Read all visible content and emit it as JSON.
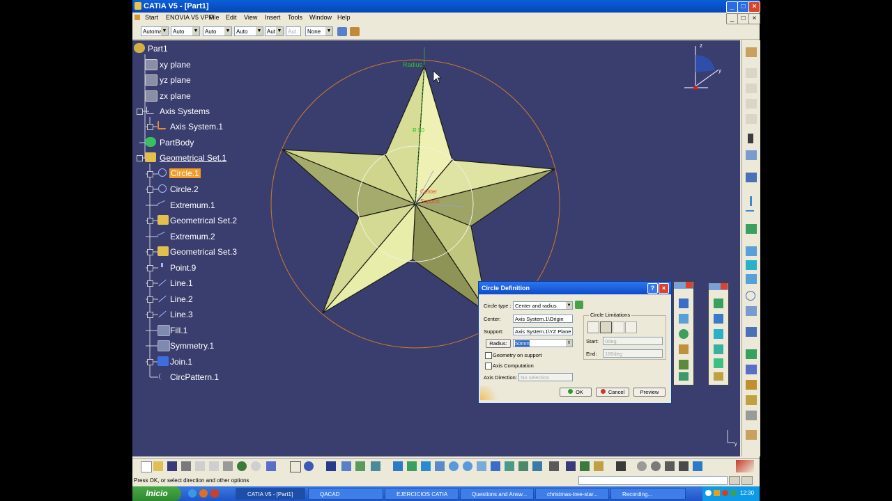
{
  "window": {
    "title": "CATIA V5 - [Part1]"
  },
  "menu": [
    "Start",
    "ENOVIA V5 VPM",
    "File",
    "Edit",
    "View",
    "Insert",
    "Tools",
    "Window",
    "Help"
  ],
  "toolbar": {
    "combos": [
      "Automa",
      "Auto",
      "Auto",
      "Auto",
      "Aut",
      "Aut",
      "None"
    ]
  },
  "tree": [
    {
      "label": "Part1",
      "icon": "part-gear-icon"
    },
    {
      "label": "xy plane",
      "icon": "plane-icon"
    },
    {
      "label": "yz plane",
      "icon": "plane-icon"
    },
    {
      "label": "zx plane",
      "icon": "plane-icon"
    },
    {
      "label": "Axis Systems",
      "icon": "axis-systems-icon"
    },
    {
      "label": "Axis System.1",
      "icon": "axis-system-icon"
    },
    {
      "label": "PartBody",
      "icon": "partbody-icon"
    },
    {
      "label": "Geometrical Set.1",
      "icon": "geometrical-set-icon"
    },
    {
      "label": "Circle.1",
      "icon": "circle-icon",
      "selected": true
    },
    {
      "label": "Circle.2",
      "icon": "circle-icon"
    },
    {
      "label": "Extremum.1",
      "icon": "extremum-icon"
    },
    {
      "label": "Geometrical Set.2",
      "icon": "geometrical-set-icon"
    },
    {
      "label": "Extremum.2",
      "icon": "extremum-icon"
    },
    {
      "label": "Geometrical Set.3",
      "icon": "geometrical-set-icon"
    },
    {
      "label": "Point.9",
      "icon": "point-icon"
    },
    {
      "label": "Line.1",
      "icon": "line-icon"
    },
    {
      "label": "Line.2",
      "icon": "line-icon"
    },
    {
      "label": "Line.3",
      "icon": "line-icon"
    },
    {
      "label": "Fill.1",
      "icon": "fill-icon"
    },
    {
      "label": "Symmetry.1",
      "icon": "symmetry-icon"
    },
    {
      "label": "Join.1",
      "icon": "join-icon"
    },
    {
      "label": "CircPattern.1",
      "icon": "circpattern-icon"
    }
  ],
  "viewport": {
    "labels": {
      "radius": "Radius",
      "center": "Center",
      "support": "Support",
      "r_label": "R 50"
    },
    "compass_axes": {
      "z": "z",
      "y": "y"
    },
    "corner_axes": "y"
  },
  "dialog": {
    "title": "Circle Definition",
    "circle_type_label": "Circle type :",
    "circle_type_value": "Center and radius",
    "center_label": "Center:",
    "center_value": "Axis System.1\\Origin",
    "support_label": "Support:",
    "support_value": "Axis System.1\\YZ Plane",
    "radius_button": "Radius:",
    "radius_value": "50mm",
    "geometry_on_support": "Geometry on support",
    "axis_computation": "Axis Computation",
    "axis_direction_label": "Axis Direction:",
    "axis_direction_value": "No selection",
    "limitations_title": "Circle Limitations",
    "start_label": "Start:",
    "start_value": "0deg",
    "end_label": "End:",
    "end_value": "180deg",
    "ok": "OK",
    "cancel": "Cancel",
    "preview": "Preview"
  },
  "status": {
    "prompt": "Press OK, or select direction and other options"
  },
  "taskbar": {
    "start": "Inicio",
    "tasks": [
      "CATIA V5 - [Part1]",
      "QACAD",
      "EJERCICIOS CATIA",
      "Questions and Answ...",
      "christmas-tree-star...",
      "Recording..."
    ],
    "clock": "12:30"
  },
  "colors": {
    "viewport_bg": "#3a3e6e",
    "star_light": "#e6eba8",
    "star_dark": "#8e9356",
    "circle_orange": "#d17a2a",
    "selection_orange": "#f39c2a"
  }
}
